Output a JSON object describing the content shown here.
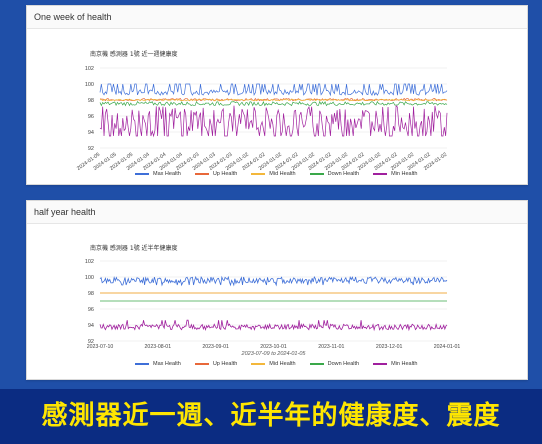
{
  "panels": [
    {
      "header": "One week of health",
      "chart_title": "南京機 感測器 1號 近一週健康度",
      "x_axis_caption": ""
    },
    {
      "header": "half year health",
      "chart_title": "南京機 感測器 1號 近半年健康度",
      "x_axis_caption": "2023-07-09 to 2024-01-05"
    }
  ],
  "banner": {
    "text": "感測器近一週、近半年的健康度、震度"
  },
  "chart_data": [
    {
      "type": "line",
      "title": "南京機 感測器 1號 近一週健康度",
      "ylim": [
        92,
        102
      ],
      "yticks": [
        "102",
        "100",
        "98",
        "96",
        "94",
        "92"
      ],
      "x_ticks": [
        "2024-01-05",
        "2024-01-05",
        "2024-01-05",
        "2024-01-04",
        "2024-01-04",
        "2024-01-04",
        "2024-01-03",
        "2024-01-03",
        "2024-01-03",
        "2024-01-02",
        "2024-01-02",
        "2024-01-02",
        "2024-01-02",
        "2024-01-02",
        "2024-01-02",
        "2024-01-02",
        "2024-01-02",
        "2024-01-02",
        "2024-01-02",
        "2024-01-02",
        "2024-01-02",
        "2024-01-02"
      ],
      "grid": true,
      "legend": "bottom",
      "series": [
        {
          "name": "Max Health",
          "color": "#3e6fd8",
          "base": 99,
          "spike_to": 100,
          "band": [
            98.6,
            99.3
          ]
        },
        {
          "name": "Up Health",
          "color": "#e8683a",
          "base": 98,
          "band": [
            97.9,
            98.2
          ]
        },
        {
          "name": "Mid Health",
          "color": "#f3b73b",
          "base": 98,
          "band": [
            97.9,
            98.1
          ]
        },
        {
          "name": "Down Health",
          "color": "#3aa84a",
          "base": 97.5,
          "band": [
            97.3,
            97.8
          ]
        },
        {
          "name": "Min Health",
          "color": "#a0209e",
          "base": 95.5,
          "band": [
            94,
            97.3
          ],
          "dip_to": 93.5
        }
      ]
    },
    {
      "type": "line",
      "title": "南京機 感測器 1號 近半年健康度",
      "ylim": [
        92,
        102
      ],
      "yticks": [
        "102",
        "100",
        "98",
        "96",
        "94",
        "92"
      ],
      "x_ticks": [
        "2023-07-10",
        "2023-08-01",
        "2023-09-01",
        "2023-10-01",
        "2023-11-01",
        "2023-12-01",
        "2024-01-01"
      ],
      "xlabel": "2023-07-09 to 2024-01-05",
      "grid": true,
      "legend": "bottom",
      "series": [
        {
          "name": "Max Health",
          "color": "#3e6fd8",
          "base": 99.6,
          "band": [
            99.2,
            100
          ],
          "dip_to": 99.0
        },
        {
          "name": "Up Health",
          "color": "#e8683a",
          "base": 98.0,
          "band": [
            98,
            98
          ]
        },
        {
          "name": "Mid Health",
          "color": "#f3b73b",
          "base": 98.0,
          "band": [
            98,
            98
          ]
        },
        {
          "name": "Down Health",
          "color": "#3aa84a",
          "base": 97.0,
          "band": [
            97,
            97
          ]
        },
        {
          "name": "Min Health",
          "color": "#a0209e",
          "base": 93.8,
          "band": [
            93.4,
            94.1
          ],
          "spike_to": 94.6
        }
      ]
    }
  ]
}
